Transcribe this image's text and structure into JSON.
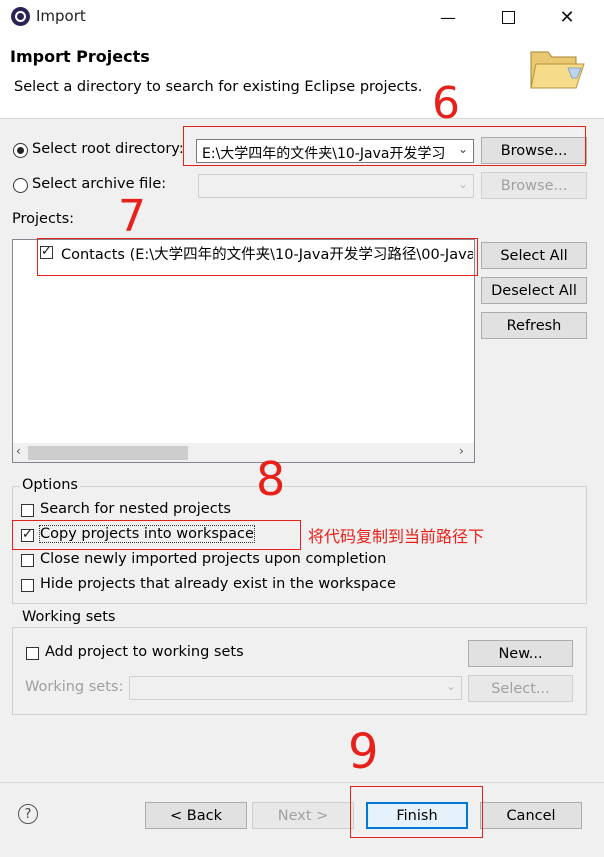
{
  "window": {
    "title": "Import"
  },
  "banner": {
    "title": "Import Projects",
    "description": "Select a directory to search for existing Eclipse projects."
  },
  "source": {
    "root_label": "Select root directory:",
    "root_selected": true,
    "root_value": "E:\\大学四年的文件夹\\10-Java开发学习",
    "archive_label": "Select archive file:",
    "archive_value": "",
    "browse_label": "Browse..."
  },
  "projects": {
    "label": "Projects:",
    "items": [
      {
        "label": "Contacts (E:\\大学四年的文件夹\\10-Java开发学习路径\\00-Java",
        "checked": true
      }
    ],
    "select_all": "Select All",
    "deselect_all": "Deselect All",
    "refresh": "Refresh"
  },
  "options": {
    "title": "Options",
    "items": [
      {
        "label": "Search for nested projects",
        "checked": false
      },
      {
        "label": "Copy projects into workspace",
        "checked": true
      },
      {
        "label": "Close newly imported projects upon completion",
        "checked": false
      },
      {
        "label": "Hide projects that already exist in the workspace",
        "checked": false
      }
    ]
  },
  "working_sets": {
    "title": "Working sets",
    "add_label": "Add project to working sets",
    "add_checked": false,
    "new_label": "New...",
    "sets_label": "Working sets:",
    "sets_value": "",
    "select_label": "Select..."
  },
  "footer": {
    "help": "?",
    "back": "< Back",
    "next": "Next >",
    "finish": "Finish",
    "cancel": "Cancel"
  },
  "annotations": {
    "six": "6",
    "seven": "7",
    "eight": "8",
    "nine": "9",
    "copy_note": "将代码复制到当前路径下",
    "color": "#e8201a"
  }
}
